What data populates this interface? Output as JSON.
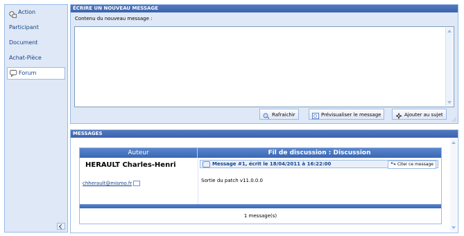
{
  "sidebar": {
    "items": [
      {
        "label": "Action",
        "icon": "action-icon"
      },
      {
        "label": "Participant"
      },
      {
        "label": "Document"
      },
      {
        "label": "Achat-Pièce"
      },
      {
        "label": "Forum",
        "icon": "forum-icon",
        "selected": true
      }
    ]
  },
  "compose": {
    "title": "ÉCRIRE UN NOUVEAU MESSAGE",
    "content_label": "Contenu du nouveau message :",
    "content_value": "",
    "buttons": {
      "refresh": "Rafraichir",
      "preview": "Prévisualiser le message",
      "add": "Ajouter au sujet"
    }
  },
  "messages": {
    "title": "MESSAGES",
    "columns": {
      "author": "Auteur",
      "thread": "Fil de discussion : Discussion"
    },
    "rows": [
      {
        "author_name": "HERAULT Charles-Henri",
        "author_email": "chherault@mismo.fr",
        "message_title": "Message #1, écrit le 18/04/2011 à 16:22:00",
        "cite_label": "Citer ce message",
        "body": "Sortie du patch v11.0.0.0"
      }
    ],
    "footer": "1 message(s)"
  },
  "colors": {
    "header_blue": "#3a63b0",
    "panel_bg": "#dfe8f6",
    "border": "#99bbe8"
  }
}
